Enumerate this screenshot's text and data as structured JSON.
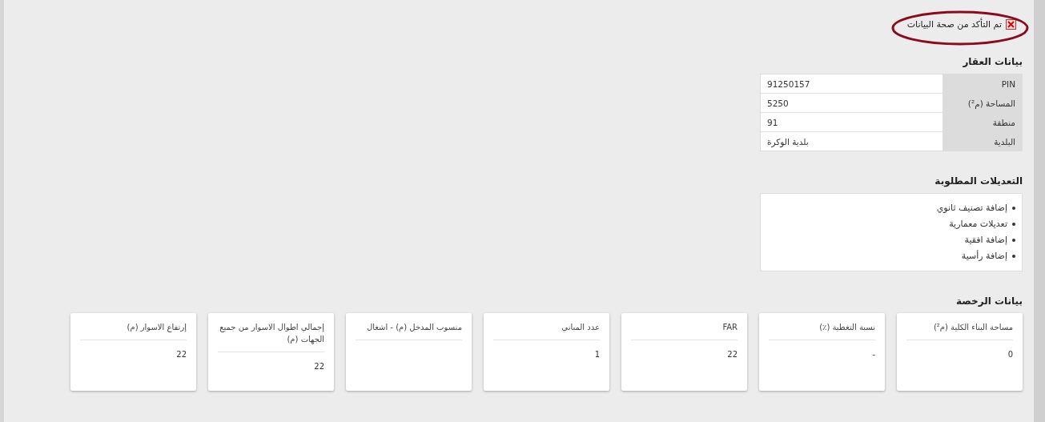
{
  "confirmation": {
    "label": "تم التأكد من صحة البيانات",
    "checked": true
  },
  "property_section": {
    "title": "بيانات العقار",
    "rows": [
      {
        "label": "PIN",
        "value": "91250157"
      },
      {
        "label": "المساحة (م²)",
        "value": "5250"
      },
      {
        "label": "منطقة",
        "value": "91"
      },
      {
        "label": "البلدية",
        "value": "بلدية الوكرة"
      }
    ]
  },
  "modifications_section": {
    "title": "التعديلات المطلوبة",
    "items": [
      "إضافة تصنيف ثانوي",
      "تعديلات معمارية",
      "إضافة افقية",
      "إضافة رأسية"
    ]
  },
  "license_section": {
    "title": "بيانات الرخصة",
    "cards": [
      {
        "label": "مساحة البناء الكلية (م²)",
        "value": "0"
      },
      {
        "label": "نسبة التغطية (٪)",
        "value": "-"
      },
      {
        "label": "FAR",
        "value": "22"
      },
      {
        "label": "عدد المباني",
        "value": "1"
      },
      {
        "label": "منسوب المدخل (م) - اشغال"
      },
      {
        "label": "إجمالي اطوال الاسوار من جميع الجهات (م)",
        "value": "22"
      },
      {
        "label": "إرتفاع الاسوار (م)",
        "value": "22"
      }
    ]
  }
}
